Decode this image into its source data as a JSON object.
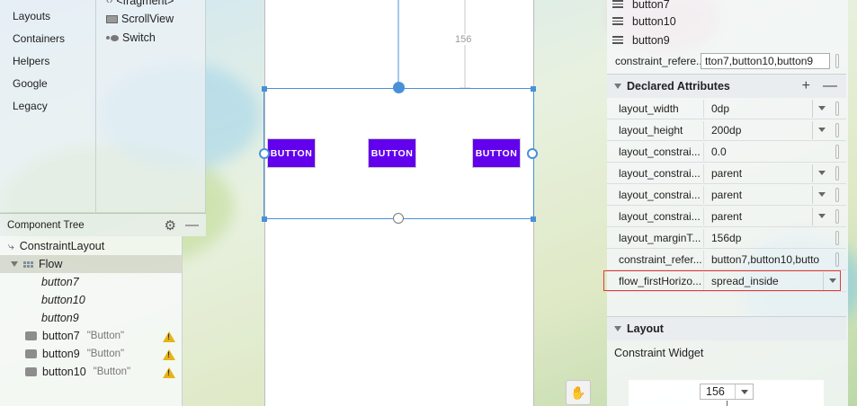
{
  "palette": {
    "categories": [
      "Layouts",
      "Containers",
      "Helpers",
      "Google",
      "Legacy"
    ],
    "items": [
      {
        "label": "<fragment>",
        "icon": "fragment-icon"
      },
      {
        "label": "ScrollView",
        "icon": "scrollview-icon"
      },
      {
        "label": "Switch",
        "icon": "switch-icon"
      }
    ]
  },
  "component_tree": {
    "title": "Component Tree",
    "root": "ConstraintLayout",
    "flow": "Flow",
    "flow_refs": [
      "button7",
      "button10",
      "button9"
    ],
    "buttons": [
      {
        "id": "button7",
        "text": "\"Button\""
      },
      {
        "id": "button9",
        "text": "\"Button\""
      },
      {
        "id": "button10",
        "text": "\"Button\""
      }
    ]
  },
  "canvas": {
    "dimension_label": "156",
    "button_label": "BUTTON"
  },
  "attributes": {
    "ref_list": [
      "button7",
      "button10",
      "button9"
    ],
    "constraint_refs_row": {
      "key": "constraint_refere...",
      "value": "tton7,button10,button9"
    },
    "declared_title": "Declared Attributes",
    "rows": [
      {
        "key": "layout_width",
        "value": "0dp",
        "dropdown": true
      },
      {
        "key": "layout_height",
        "value": "200dp",
        "dropdown": true
      },
      {
        "key": "layout_constrai...",
        "value": "0.0",
        "dropdown": false
      },
      {
        "key": "layout_constrai...",
        "value": "parent",
        "dropdown": true
      },
      {
        "key": "layout_constrai...",
        "value": "parent",
        "dropdown": true
      },
      {
        "key": "layout_constrai...",
        "value": "parent",
        "dropdown": true
      },
      {
        "key": "layout_marginT...",
        "value": "156dp",
        "dropdown": false
      },
      {
        "key": "constraint_refer...",
        "value": "button7,button10,butto",
        "dropdown": false
      },
      {
        "key": "flow_firstHorizo...",
        "value": "spread_inside",
        "dropdown": true
      }
    ],
    "layout_title": "Layout",
    "constraint_widget_label": "Constraint Widget",
    "constraint_widget_value": "156"
  },
  "colors": {
    "button": "#6200ee",
    "selection": "#4a90d9",
    "highlight": "#e53935",
    "warning": "#e7b417"
  }
}
